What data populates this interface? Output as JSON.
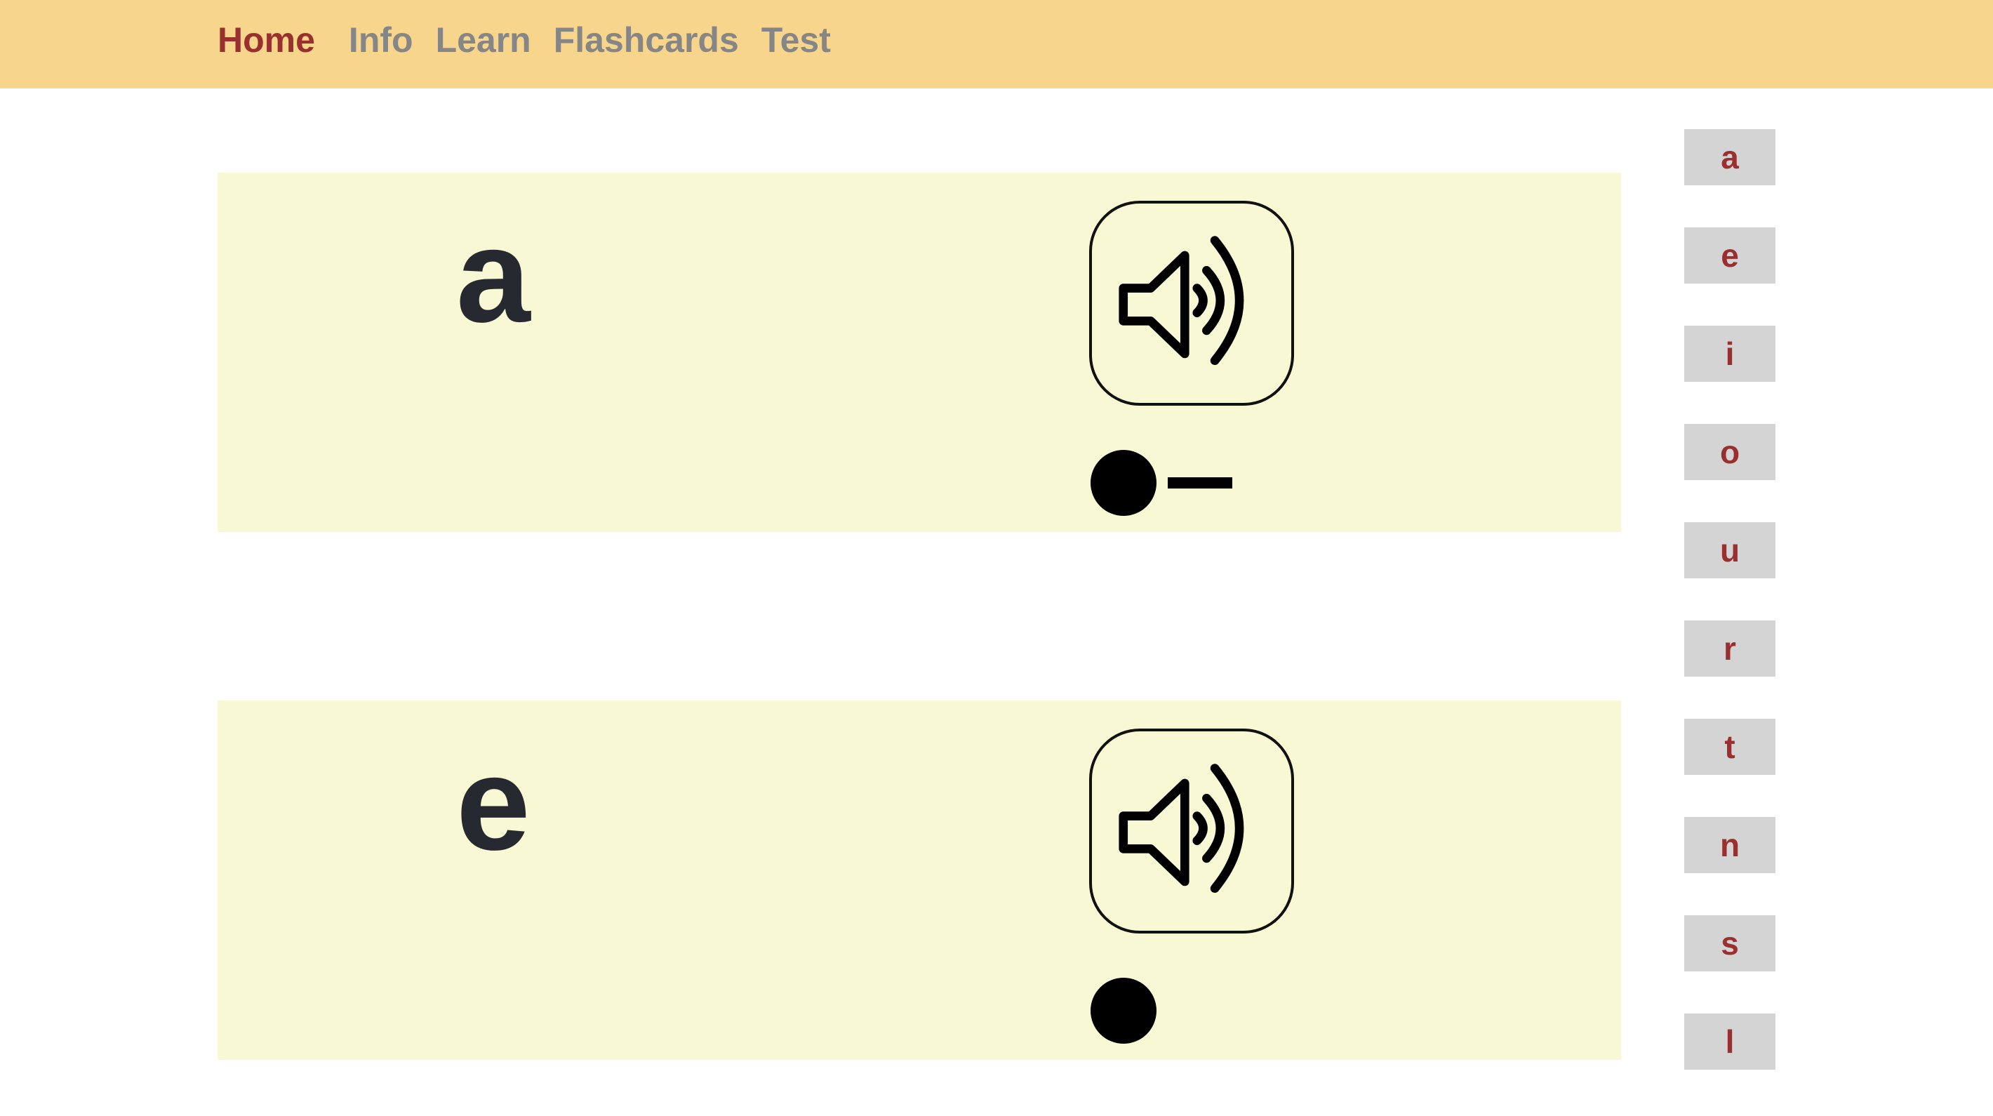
{
  "nav": {
    "items": [
      {
        "label": "Home",
        "active": true
      },
      {
        "label": "Info",
        "active": false
      },
      {
        "label": "Learn",
        "active": false
      },
      {
        "label": "Flashcards",
        "active": false
      },
      {
        "label": "Test",
        "active": false
      }
    ]
  },
  "cards": [
    {
      "letter": "a",
      "morse": [
        "dot",
        "dash"
      ],
      "sound_icon": "speaker-icon"
    },
    {
      "letter": "e",
      "morse": [
        "dot"
      ],
      "sound_icon": "speaker-icon"
    }
  ],
  "sidebar": {
    "letters": [
      "a",
      "e",
      "i",
      "o",
      "u",
      "r",
      "t",
      "n",
      "s",
      "l"
    ]
  },
  "colors": {
    "topbar": "#f7d58c",
    "card_bg": "#f8f8d4",
    "active_nav": "#9a2f2f",
    "inactive_nav": "#868686",
    "side_key_bg": "#d4d4d4",
    "side_key_text": "#9a2f2f"
  }
}
